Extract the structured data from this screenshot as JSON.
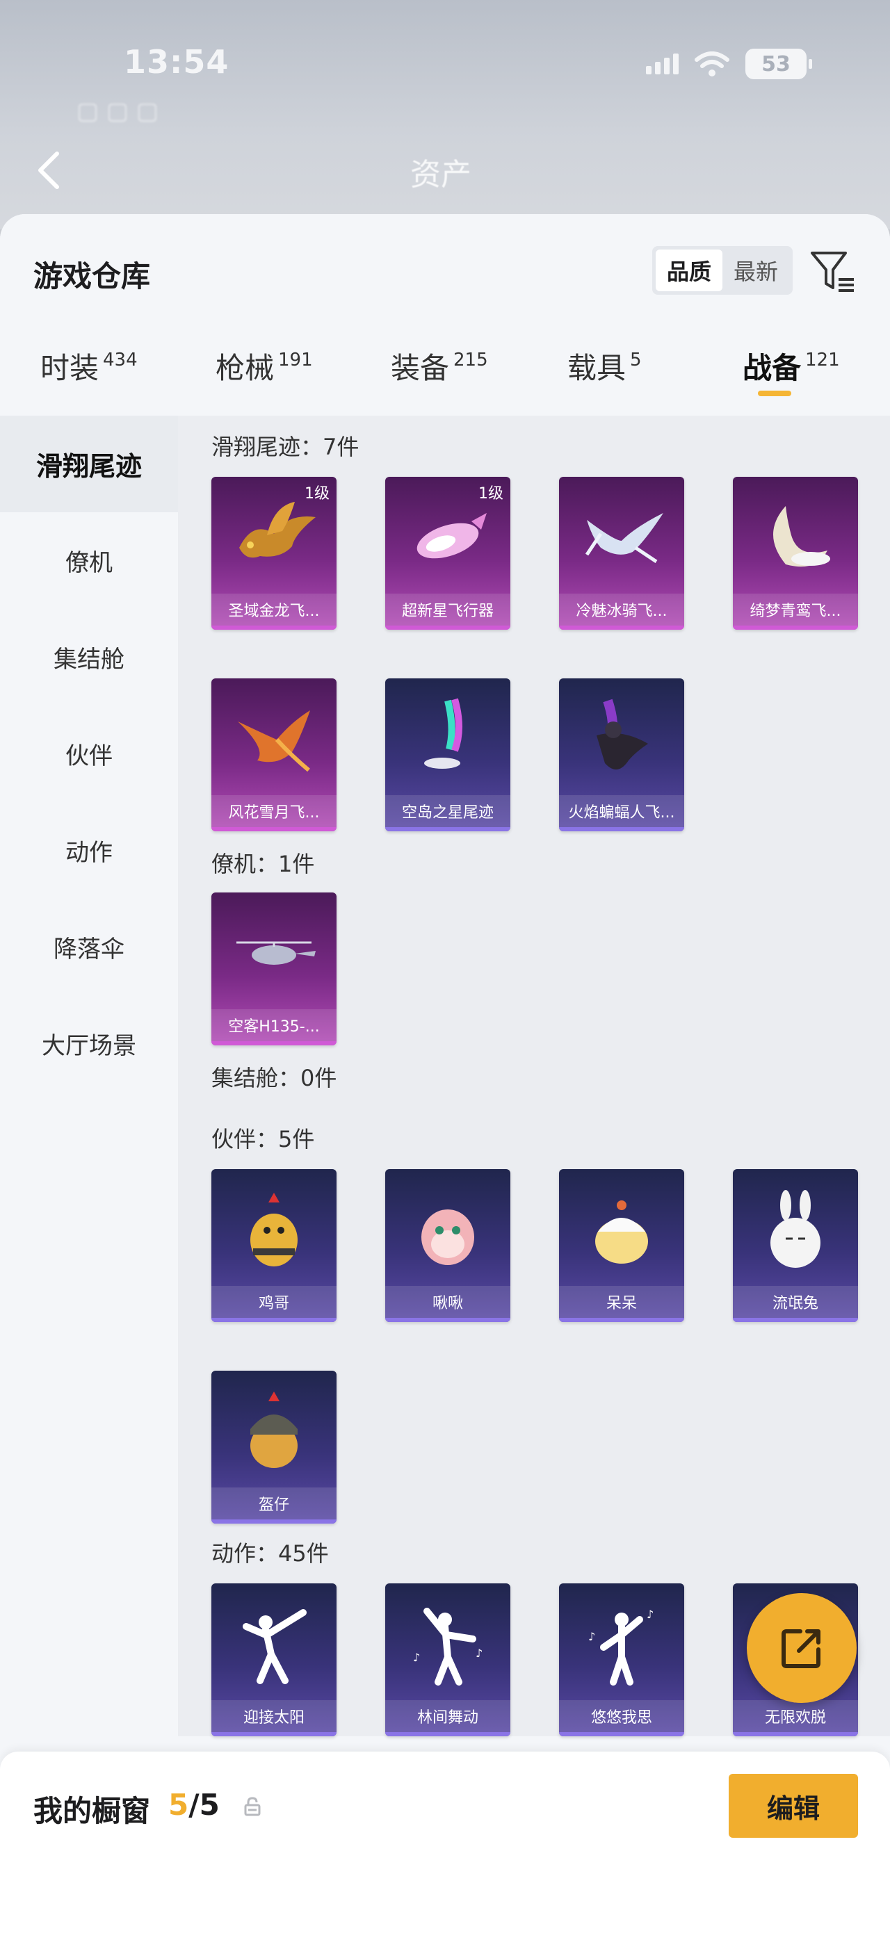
{
  "status_bar": {
    "time": "13:54",
    "battery": "53"
  },
  "background_header": {
    "title": "资产"
  },
  "sheet": {
    "title": "游戏仓库",
    "sort_options": [
      "品质",
      "最新"
    ],
    "active_sort": "品质"
  },
  "tabs": [
    {
      "label": "时装",
      "count": "434"
    },
    {
      "label": "枪械",
      "count": "191"
    },
    {
      "label": "装备",
      "count": "215"
    },
    {
      "label": "载具",
      "count": "5"
    },
    {
      "label": "战备",
      "count": "121"
    }
  ],
  "active_tab": "战备",
  "sidebar": {
    "items": [
      "滑翔尾迹",
      "僚机",
      "集结舱",
      "伙伴",
      "动作",
      "降落伞",
      "大厅场景"
    ],
    "active": "滑翔尾迹"
  },
  "sections": {
    "glide": {
      "title": "滑翔尾迹：7件",
      "items": [
        {
          "name": "圣域金龙飞...",
          "level": "1级"
        },
        {
          "name": "超新星飞行器",
          "level": "1级"
        },
        {
          "name": "冷魅冰骑飞..."
        },
        {
          "name": "绮梦青鸾飞..."
        },
        {
          "name": "风花雪月飞..."
        },
        {
          "name": "空岛之星尾迹"
        },
        {
          "name": "火焰蝙蝠人飞..."
        }
      ]
    },
    "wingman": {
      "title": "僚机：1件",
      "items": [
        {
          "name": "空客H135-..."
        }
      ]
    },
    "capsule": {
      "title": "集结舱：0件"
    },
    "partner": {
      "title": "伙伴：5件",
      "items": [
        {
          "name": "鸡哥"
        },
        {
          "name": "啾啾"
        },
        {
          "name": "呆呆"
        },
        {
          "name": "流氓兔"
        },
        {
          "name": "盔仔"
        }
      ]
    },
    "emote": {
      "title": "动作：45件",
      "items": [
        {
          "name": "迎接太阳"
        },
        {
          "name": "林间舞动"
        },
        {
          "name": "悠悠我思"
        },
        {
          "name": "无限欢脱"
        }
      ]
    }
  },
  "showcase": {
    "label": "我的橱窗",
    "current": "5",
    "total": "/5",
    "edit_label": "编辑"
  }
}
